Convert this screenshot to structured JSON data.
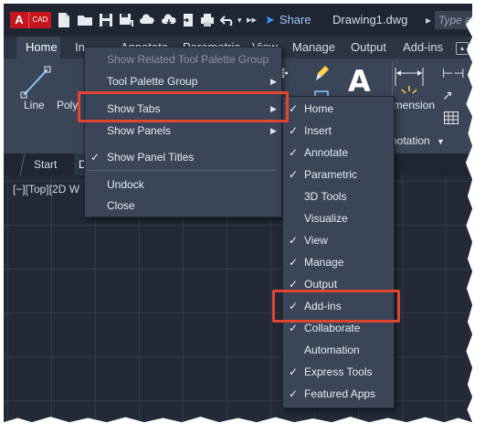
{
  "app": {
    "logo_letter": "A",
    "logo_suffix": "CAD",
    "share_label": "Share",
    "document_title": "Drawing1.dwg",
    "search_placeholder": "Type a"
  },
  "ribbon_tabs": [
    "Home",
    "In",
    "Annotate",
    "Parametric",
    "View",
    "Manage",
    "Output",
    "Add-ins"
  ],
  "ribbon": {
    "line_label": "Line",
    "polyline_label": "Poly",
    "dimension_label": "imension",
    "annotation_label": "notation"
  },
  "file_tabs": {
    "start_label": "Start",
    "drawing_label": "D"
  },
  "viewport_label": "[−][Top][2D W",
  "menu_primary": {
    "items": [
      {
        "label": "Show Related Tool Palette Group",
        "checked": false,
        "submenu": false,
        "disabled": true
      },
      {
        "label": "Tool Palette Group",
        "checked": false,
        "submenu": true,
        "disabled": false
      },
      {
        "label": "Show Tabs",
        "checked": false,
        "submenu": true,
        "disabled": false
      },
      {
        "label": "Show Panels",
        "checked": false,
        "submenu": true,
        "disabled": false
      },
      {
        "label": "Show Panel Titles",
        "checked": true,
        "submenu": false,
        "disabled": false
      },
      {
        "label": "Undock",
        "checked": false,
        "submenu": false,
        "disabled": false
      },
      {
        "label": "Close",
        "checked": false,
        "submenu": false,
        "disabled": false
      }
    ]
  },
  "menu_tabs": {
    "items": [
      {
        "label": "Home",
        "checked": true
      },
      {
        "label": "Insert",
        "checked": true
      },
      {
        "label": "Annotate",
        "checked": true
      },
      {
        "label": "Parametric",
        "checked": true
      },
      {
        "label": "3D Tools",
        "checked": false
      },
      {
        "label": "Visualize",
        "checked": false
      },
      {
        "label": "View",
        "checked": true
      },
      {
        "label": "Manage",
        "checked": true
      },
      {
        "label": "Output",
        "checked": true
      },
      {
        "label": "Add-ins",
        "checked": true
      },
      {
        "label": "Collaborate",
        "checked": true
      },
      {
        "label": "Automation",
        "checked": false
      },
      {
        "label": "Express Tools",
        "checked": true
      },
      {
        "label": "Featured Apps",
        "checked": true
      }
    ]
  },
  "colors": {
    "highlight": "#e0452f",
    "menu_background": "#3b4558",
    "canvas_background": "#232937",
    "logo_red": "#c4161c"
  }
}
